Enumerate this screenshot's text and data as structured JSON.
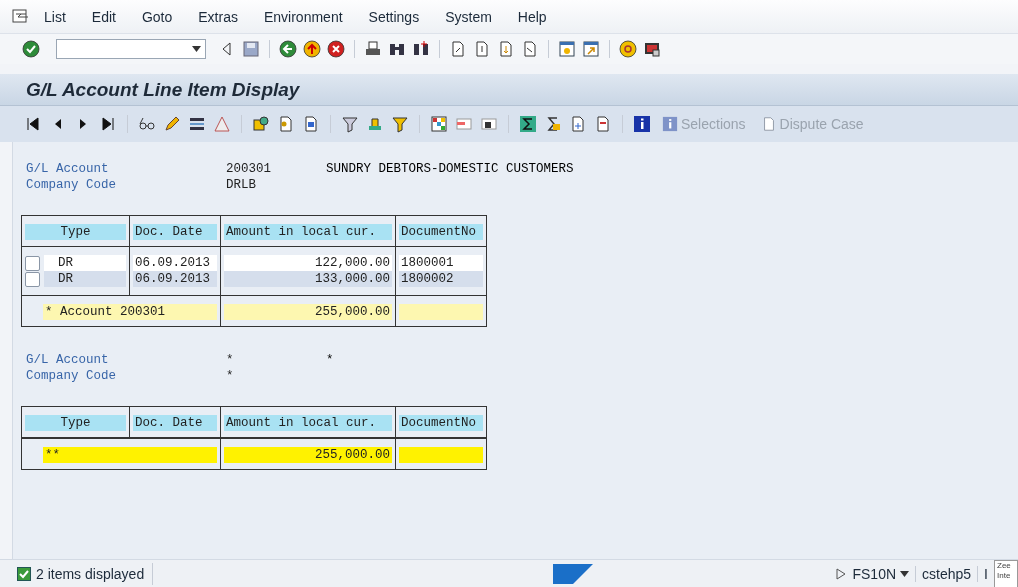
{
  "menu": [
    "List",
    "Edit",
    "Goto",
    "Extras",
    "Environment",
    "Settings",
    "System",
    "Help"
  ],
  "title": "G/L Account Line Item Display",
  "app_toolbar": [
    {
      "label": "Selections",
      "disabled": true
    },
    {
      "label": "Dispute Case",
      "disabled": true
    }
  ],
  "sections": [
    {
      "header": [
        {
          "label": "G/L Account",
          "value": "200301",
          "extra": "SUNDRY DEBTORS-DOMESTIC CUSTOMERS"
        },
        {
          "label": "Company Code",
          "value": "DRLB"
        }
      ],
      "table": {
        "columns": [
          "Type",
          "Doc. Date",
          "Amount in local cur.",
          "DocumentNo"
        ],
        "rows": [
          {
            "kind": "item",
            "checked": false,
            "cells": [
              "DR",
              "06.09.2013",
              "122,000.00",
              "1800001"
            ]
          },
          {
            "kind": "item",
            "checked": false,
            "cells": [
              "DR",
              "06.09.2013",
              "133,000.00",
              "1800002"
            ]
          },
          {
            "kind": "subtotal",
            "label": "* Account 200301",
            "amount": "255,000.00"
          }
        ]
      }
    },
    {
      "header": [
        {
          "label": "G/L Account",
          "value": "*",
          "extra": "*"
        },
        {
          "label": "Company Code",
          "value": "*"
        }
      ],
      "table": {
        "columns": [
          "Type",
          "Doc. Date",
          "Amount in local cur.",
          "DocumentNo"
        ],
        "rows": [
          {
            "kind": "total",
            "label": "**",
            "amount": "255,000.00"
          }
        ]
      }
    }
  ],
  "status_bar": {
    "message": "2 items displayed",
    "transaction": "FS10N",
    "server": "cstehp5",
    "cut": "I",
    "popup": [
      "Zee",
      "Inte"
    ]
  }
}
